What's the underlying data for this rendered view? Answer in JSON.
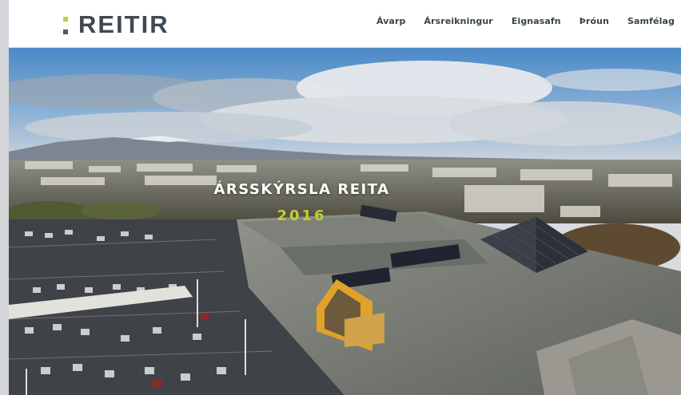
{
  "brand": {
    "name": "REITIR",
    "accent": "#c4cc32",
    "dark": "#3f4a50"
  },
  "nav": [
    {
      "label": "Ávarp"
    },
    {
      "label": "Ársreikningur"
    },
    {
      "label": "Eignasafn"
    },
    {
      "label": "Þróun"
    },
    {
      "label": "Samfélag"
    }
  ],
  "hero": {
    "title": "ÁRSSKÝRSLA REITA",
    "year": "2016"
  }
}
